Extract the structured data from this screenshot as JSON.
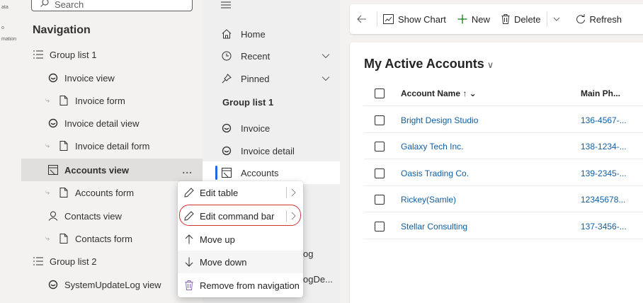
{
  "rail": {
    "line1": "ata",
    "line2": "o",
    "line3": "mation"
  },
  "nav": {
    "search_placeholder": "Search",
    "title": "Navigation",
    "items": [
      {
        "label": "Group list 1",
        "icon": "group-list-icon",
        "kind": "group"
      },
      {
        "label": "Invoice view",
        "icon": "view-icon",
        "kind": "view"
      },
      {
        "label": "Invoice form",
        "icon": "form-icon",
        "kind": "form"
      },
      {
        "label": "Invoice detail view",
        "icon": "view-icon",
        "kind": "view"
      },
      {
        "label": "Invoice detail form",
        "icon": "form-icon",
        "kind": "form"
      },
      {
        "label": "Accounts view",
        "icon": "table-view-icon",
        "kind": "view",
        "selected": true
      },
      {
        "label": "Accounts form",
        "icon": "form-icon",
        "kind": "form"
      },
      {
        "label": "Contacts view",
        "icon": "person-icon",
        "kind": "view"
      },
      {
        "label": "Contacts form",
        "icon": "form-icon",
        "kind": "form"
      },
      {
        "label": "Group list 2",
        "icon": "group-list-icon",
        "kind": "group"
      },
      {
        "label": "SystemUpdateLog view",
        "icon": "view-icon",
        "kind": "view"
      }
    ],
    "more": "..."
  },
  "sitemap": {
    "home": "Home",
    "recent": "Recent",
    "pinned": "Pinned",
    "group": "Group list 1",
    "invoice": "Invoice",
    "invoice_detail": "Invoice detail",
    "accounts": "Accounts",
    "partial1": "og",
    "partial2": "ogDe..."
  },
  "commandbar": {
    "show_chart": "Show Chart",
    "new": "New",
    "delete": "Delete",
    "refresh": "Refresh"
  },
  "view": {
    "title": "My Active Accounts",
    "col_name": "Account Name ↑ ⌄",
    "col_phone": "Main Ph...",
    "rows": [
      {
        "name": "Bright Design Studio",
        "phone": "136-4567-..."
      },
      {
        "name": "Galaxy Tech Inc.",
        "phone": "138-1234-..."
      },
      {
        "name": "Oasis Trading Co.",
        "phone": "139-2345-..."
      },
      {
        "name": "Rickey(Samle)",
        "phone": "12345678..."
      },
      {
        "name": "Stellar Consulting",
        "phone": "137-3456-..."
      }
    ]
  },
  "context_menu": {
    "edit_table": "Edit table",
    "edit_command_bar": "Edit command bar",
    "move_up": "Move up",
    "move_down": "Move down",
    "remove": "Remove from navigation"
  },
  "colors": {
    "accent": "#2266e3",
    "link": "#115ea3",
    "highlight_ring": "#d13438",
    "selected_row": "#e1dfdd"
  }
}
